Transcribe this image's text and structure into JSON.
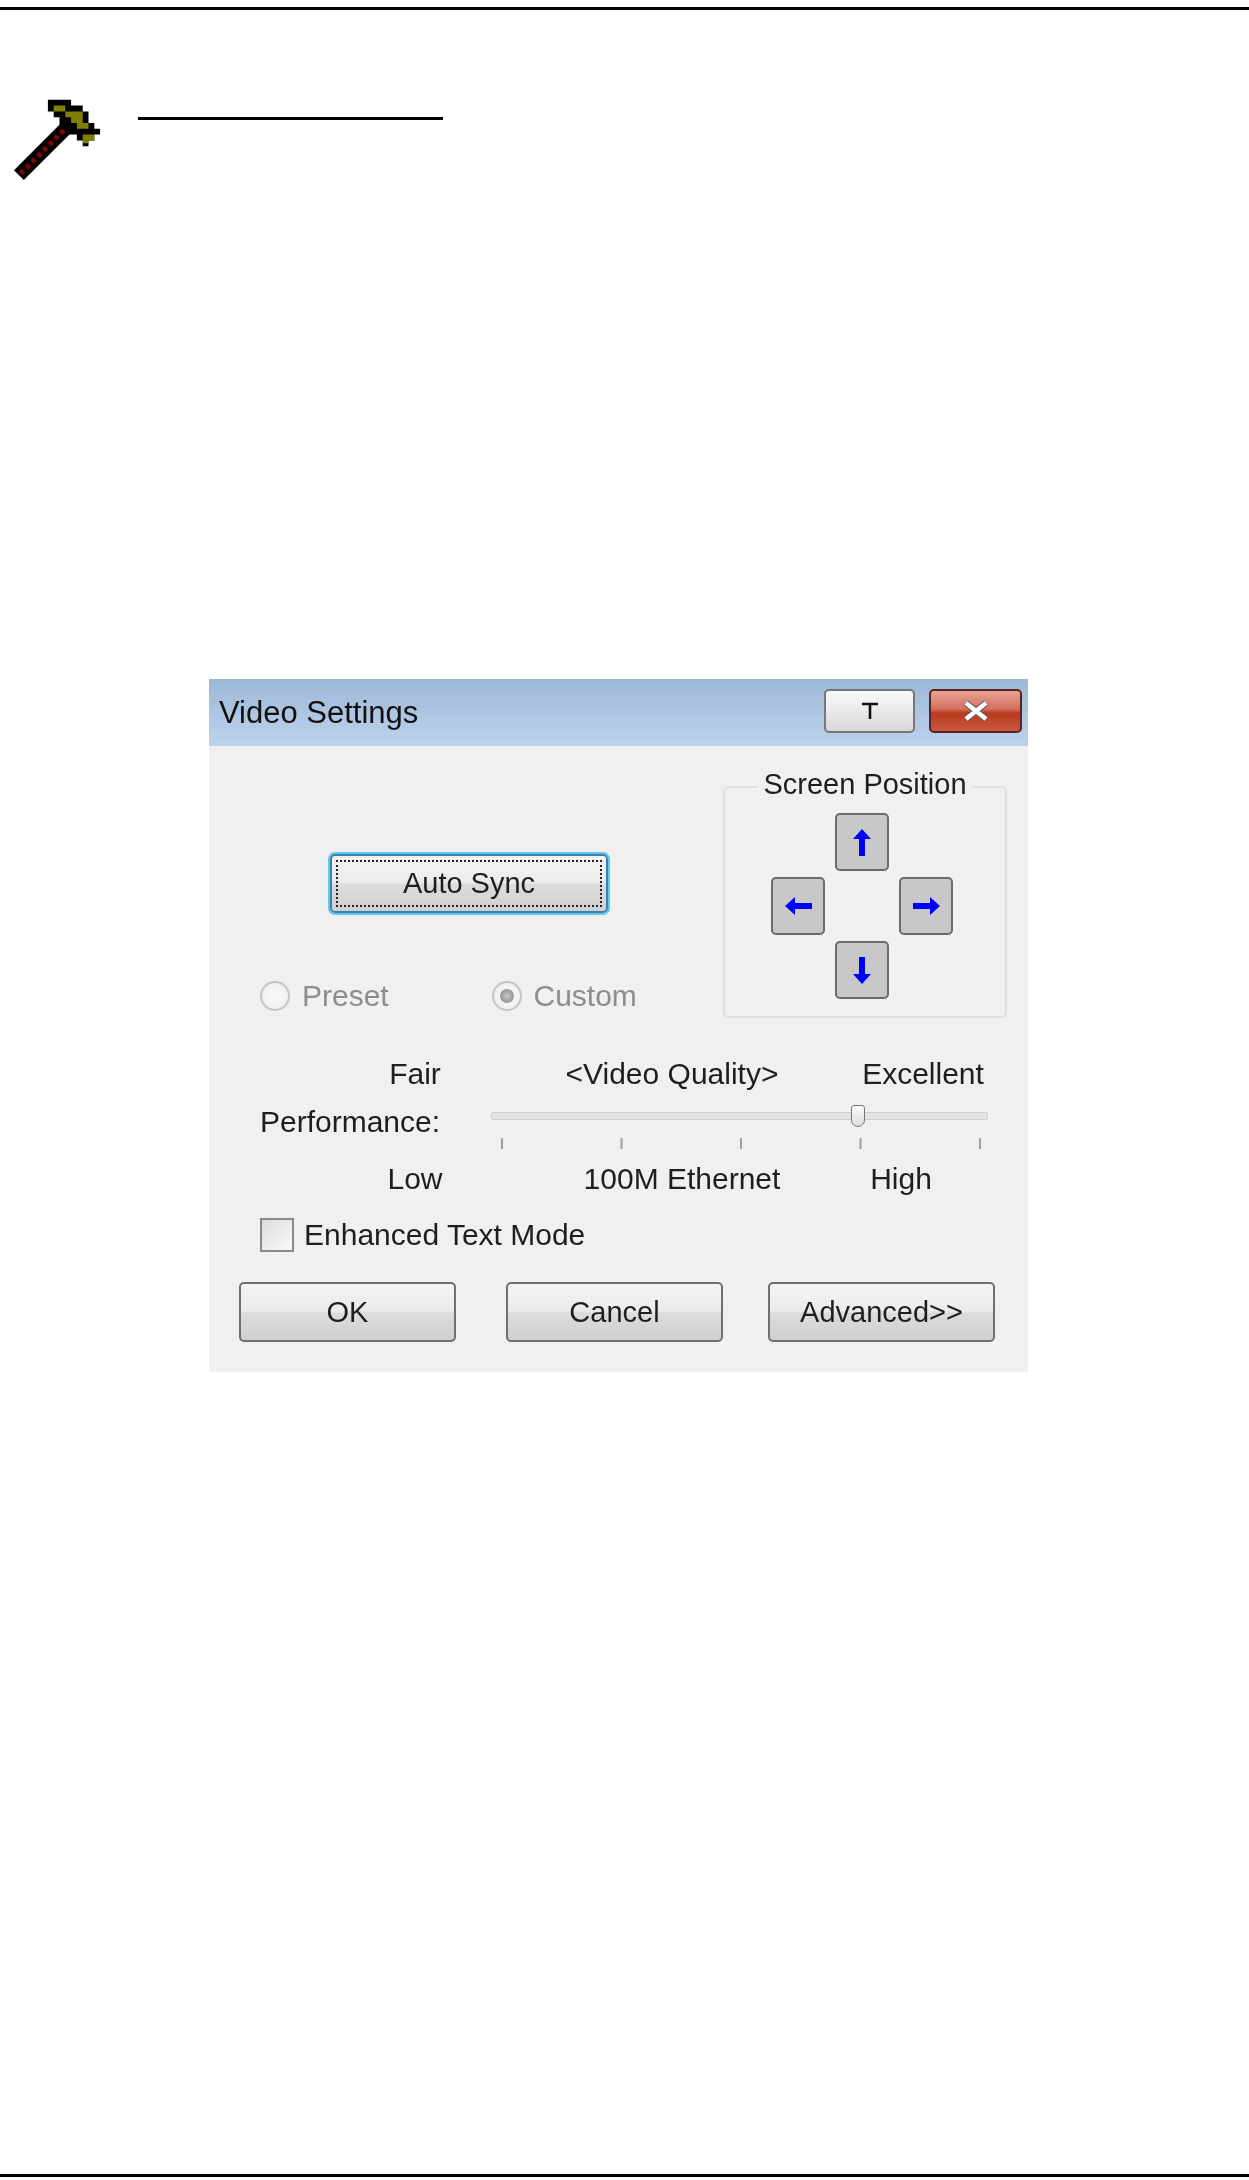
{
  "dialog": {
    "title": "Video Settings",
    "title_buttons": [
      {
        "kind": "pin"
      },
      {
        "kind": "close"
      }
    ],
    "auto_sync": {
      "label": "Auto Sync",
      "focused": true
    },
    "mode_options": [
      {
        "label": "Preset",
        "selected": false,
        "disabled": true
      },
      {
        "label": "Custom",
        "selected": true,
        "disabled": true
      }
    ],
    "screen_position": {
      "title": "Screen Position",
      "buttons": [
        {
          "kind": "up"
        },
        {
          "kind": "left"
        },
        {
          "kind": "right"
        },
        {
          "kind": "down"
        }
      ]
    },
    "quality": {
      "low_label": "Fair",
      "caption": "<Video Quality>",
      "high_label": "Excellent"
    },
    "performance": {
      "label": "Performance:",
      "level": 0.75,
      "low_label": "Low",
      "mid_label": "100M Ethernet",
      "high_label": "High"
    },
    "enhanced_text_mode": {
      "label": "Enhanced Text Mode",
      "checked": false
    },
    "buttons": [
      {
        "label": "OK"
      },
      {
        "label": "Cancel"
      },
      {
        "label": "Advanced>>"
      }
    ]
  }
}
